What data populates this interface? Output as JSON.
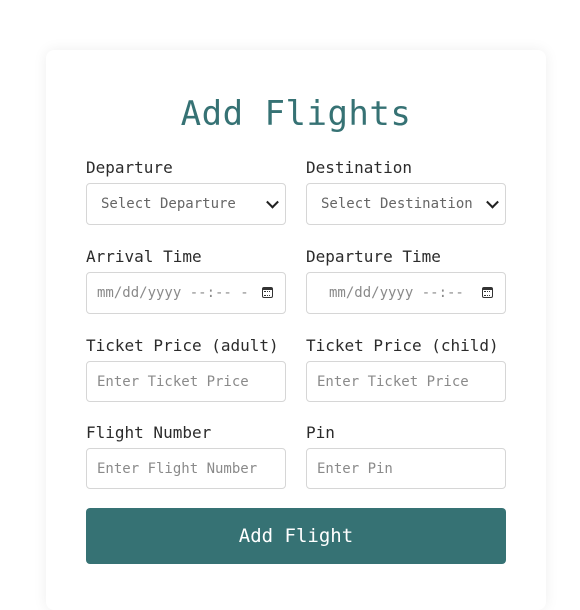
{
  "title": "Add Flights",
  "fields": {
    "departure": {
      "label": "Departure",
      "value": "Select Departure"
    },
    "destination": {
      "label": "Destination",
      "value": "Select Destination"
    },
    "arrival_time": {
      "label": "Arrival Time",
      "value": "mm/dd/yyyy --:-- -"
    },
    "departure_time": {
      "label": "Departure Time",
      "value": "mm/dd/yyyy --:--"
    },
    "price_adult": {
      "label": "Ticket Price (adult)",
      "placeholder": "Enter Ticket Price"
    },
    "price_child": {
      "label": "Ticket Price (child)",
      "placeholder": "Enter Ticket Price"
    },
    "flight_number": {
      "label": "Flight Number",
      "placeholder": "Enter Flight Number"
    },
    "pin": {
      "label": "Pin",
      "placeholder": "Enter Pin"
    }
  },
  "submit_label": "Add Flight",
  "colors": {
    "accent": "#367274"
  }
}
